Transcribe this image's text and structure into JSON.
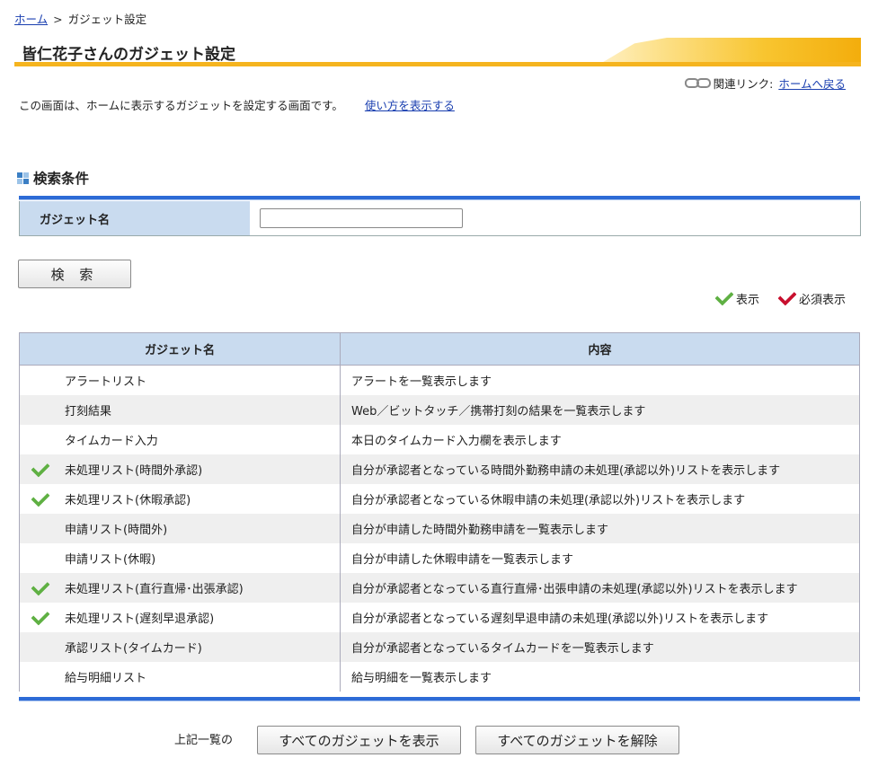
{
  "breadcrumb": {
    "home": "ホーム",
    "separator": ">",
    "current": "ガジェット設定"
  },
  "page_title": "皆仁花子さんのガジェット設定",
  "related": {
    "label": "関連リンク:",
    "link": "ホームへ戻る"
  },
  "description": {
    "text": "この画面は、ホームに表示するガジェットを設定する画面です。",
    "help_link": "使い方を表示する"
  },
  "search": {
    "section_title": "検索条件",
    "field_label": "ガジェット名",
    "field_value": "",
    "button_label": "検 索"
  },
  "legend": {
    "display": "表示",
    "required": "必須表示"
  },
  "table": {
    "headers": [
      "ガジェット名",
      "内容"
    ],
    "rows": [
      {
        "name": "アラートリスト",
        "content": "アラートを一覧表示します",
        "checked": false
      },
      {
        "name": "打刻結果",
        "content": "Web／ビットタッチ／携帯打刻の結果を一覧表示します",
        "checked": false
      },
      {
        "name": "タイムカード入力",
        "content": "本日のタイムカード入力欄を表示します",
        "checked": false
      },
      {
        "name": "未処理リスト(時間外承認)",
        "content": "自分が承認者となっている時間外勤務申請の未処理(承認以外)リストを表示します",
        "checked": true
      },
      {
        "name": "未処理リスト(休暇承認)",
        "content": "自分が承認者となっている休暇申請の未処理(承認以外)リストを表示します",
        "checked": true
      },
      {
        "name": "申請リスト(時間外)",
        "content": "自分が申請した時間外勤務申請を一覧表示します",
        "checked": false
      },
      {
        "name": "申請リスト(休暇)",
        "content": "自分が申請した休暇申請を一覧表示します",
        "checked": false
      },
      {
        "name": "未処理リスト(直行直帰･出張承認)",
        "content": "自分が承認者となっている直行直帰･出張申請の未処理(承認以外)リストを表示します",
        "checked": true
      },
      {
        "name": "未処理リスト(遅刻早退承認)",
        "content": "自分が承認者となっている遅刻早退申請の未処理(承認以外)リストを表示します",
        "checked": true
      },
      {
        "name": "承認リスト(タイムカード)",
        "content": "自分が承認者となっているタイムカードを一覧表示します",
        "checked": false
      },
      {
        "name": "給与明細リスト",
        "content": "給与明細を一覧表示します",
        "checked": false
      }
    ]
  },
  "footer": {
    "label": "上記一覧の",
    "show_all": "すべてのガジェットを表示",
    "clear_all": "すべてのガジェットを解除"
  },
  "colors": {
    "accent_blue": "#2d6bd6",
    "header_bg": "#c9dbef",
    "check_green": "#5fb043",
    "check_red": "#c8102e",
    "title_stripe": "#f5b41e"
  }
}
